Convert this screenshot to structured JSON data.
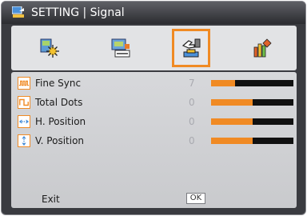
{
  "header": {
    "title": "SETTING | Signal",
    "icon": "setting-icon"
  },
  "tabs": [
    {
      "icon": "image-settings-icon",
      "active": false
    },
    {
      "icon": "display-settings-icon",
      "active": false
    },
    {
      "icon": "setting-hand-icon",
      "active": true
    },
    {
      "icon": "options-icon",
      "active": false
    }
  ],
  "settings": [
    {
      "label": "Fine Sync",
      "value": "7",
      "level": 0.29,
      "icon": "waveform-icon"
    },
    {
      "label": "Total Dots",
      "value": "0",
      "level": 0.5,
      "icon": "pulse-icon"
    },
    {
      "label": "H. Position",
      "value": "0",
      "level": 0.5,
      "icon": "horizontal-arrows-icon"
    },
    {
      "label": "V. Position",
      "value": "0",
      "level": 0.5,
      "icon": "vertical-arrows-icon"
    }
  ],
  "footer": {
    "exit_label": "Exit",
    "ok_label": "OK"
  },
  "colors": {
    "accent": "#f08a24",
    "panel": "#d3d4d7",
    "frame": "#3a3b40",
    "value_text": "#a9aab0"
  }
}
